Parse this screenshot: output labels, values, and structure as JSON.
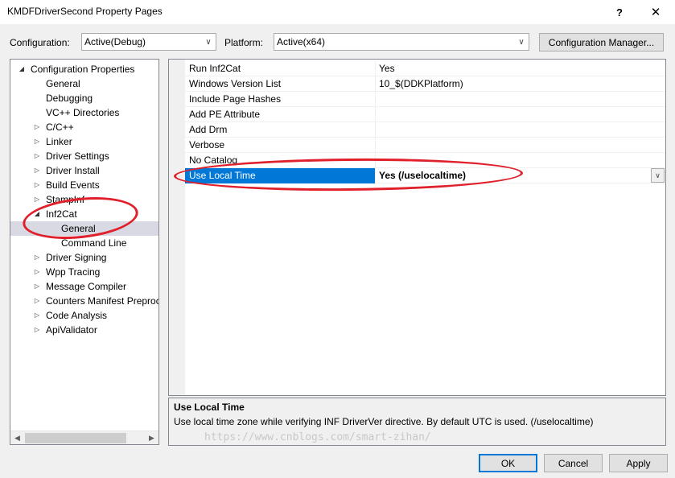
{
  "window": {
    "title": "KMDFDriverSecond Property Pages",
    "help_glyph": "?",
    "close_glyph": "✕"
  },
  "config": {
    "configuration_label": "Configuration:",
    "configuration_value": "Active(Debug)",
    "platform_label": "Platform:",
    "platform_value": "Active(x64)",
    "manager_button": "Configuration Manager..."
  },
  "tree": {
    "items": [
      {
        "label": "Configuration Properties",
        "expanded": true
      },
      {
        "label": "General"
      },
      {
        "label": "Debugging"
      },
      {
        "label": "VC++ Directories"
      },
      {
        "label": "C/C++",
        "expanded": false
      },
      {
        "label": "Linker",
        "expanded": false
      },
      {
        "label": "Driver Settings",
        "expanded": false
      },
      {
        "label": "Driver Install",
        "expanded": false
      },
      {
        "label": "Build Events",
        "expanded": false
      },
      {
        "label": "StampInf",
        "expanded": false
      },
      {
        "label": "Inf2Cat",
        "expanded": true
      },
      {
        "label": "General",
        "selected": true
      },
      {
        "label": "Command Line"
      },
      {
        "label": "Driver Signing",
        "expanded": false
      },
      {
        "label": "Wpp Tracing",
        "expanded": false
      },
      {
        "label": "Message Compiler",
        "expanded": false
      },
      {
        "label": "Counters Manifest Preproc",
        "expanded": false
      },
      {
        "label": "Code Analysis",
        "expanded": false
      },
      {
        "label": "ApiValidator",
        "expanded": false
      }
    ]
  },
  "grid": {
    "rows": [
      {
        "name": "Run Inf2Cat",
        "value": "Yes"
      },
      {
        "name": "Windows Version List",
        "value": "10_$(DDKPlatform)"
      },
      {
        "name": "Include Page Hashes",
        "value": ""
      },
      {
        "name": "Add PE Attribute",
        "value": ""
      },
      {
        "name": "Add Drm",
        "value": ""
      },
      {
        "name": "Verbose",
        "value": ""
      },
      {
        "name": "No Catalog",
        "value": ""
      },
      {
        "name": "Use Local Time",
        "value": "Yes (/uselocaltime)",
        "selected": true
      }
    ]
  },
  "description": {
    "title": "Use Local Time",
    "text": "Use local time zone while verifying INF DriverVer directive. By default UTC is used.  (/uselocaltime)",
    "watermark": "https://www.cnblogs.com/smart-zihan/"
  },
  "buttons": {
    "ok": "OK",
    "cancel": "Cancel",
    "apply": "Apply"
  },
  "colors": {
    "selection": "#0078d7",
    "annotation": "#e0202a"
  }
}
